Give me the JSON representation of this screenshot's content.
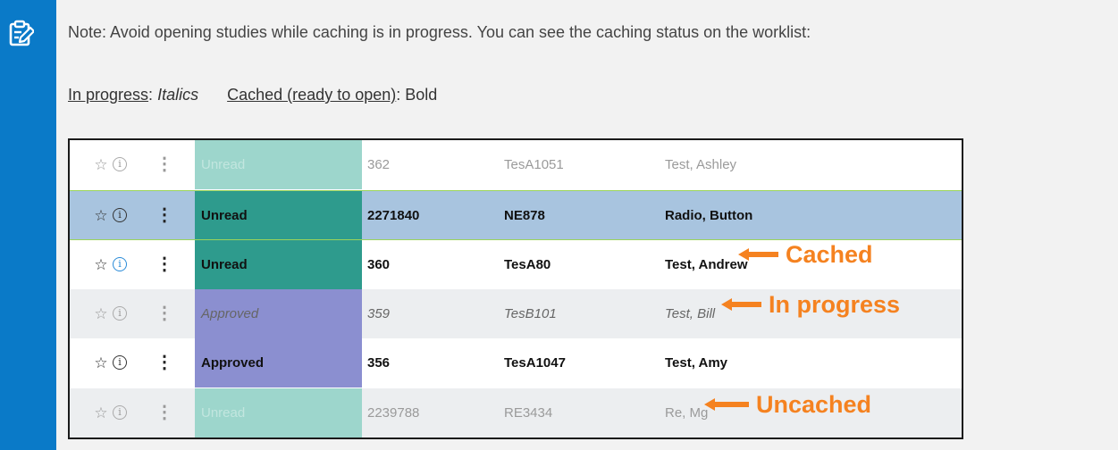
{
  "note": {
    "icon": "note-pencil-icon",
    "accent_color": "#0a7ac8",
    "text": "Note: Avoid opening studies while caching is in progress. You can see the caching status on the worklist:"
  },
  "legend": {
    "in_progress_label": "In progress",
    "colon1": ":",
    "in_progress_value": "Italics",
    "cached_label": "Cached (ready to open)",
    "colon2": ":",
    "cached_value": "Bold"
  },
  "worklist": {
    "rows": [
      {
        "status": "Unread",
        "accession": "362",
        "patient_id": "TesA1051",
        "name": "Test, Ashley",
        "state": "uncached",
        "bg": "#ffffff",
        "status_bg": "#9dd6cc",
        "selected": false
      },
      {
        "status": "Unread",
        "accession": "2271840",
        "patient_id": "NE878",
        "name": "Radio, Button",
        "state": "cached",
        "bg": "#a8c4df",
        "status_bg": "#2e9b8d",
        "selected": true
      },
      {
        "status": "Unread",
        "accession": "360",
        "patient_id": "TesA80",
        "name": "Test, Andrew",
        "state": "cached",
        "bg": "#ffffff",
        "status_bg": "#2e9b8d",
        "selected": false
      },
      {
        "status": "Approved",
        "accession": "359",
        "patient_id": "TesB101",
        "name": "Test, Bill",
        "state": "in-progress",
        "bg": "#eceef0",
        "status_bg": "#8b8fd0",
        "selected": false
      },
      {
        "status": "Approved",
        "accession": "356",
        "patient_id": "TesA1047",
        "name": "Test, Amy",
        "state": "cached",
        "bg": "#ffffff",
        "status_bg": "#8b8fd0",
        "selected": false
      },
      {
        "status": "Unread",
        "accession": "2239788",
        "patient_id": "RE3434",
        "name": "Re, Mg",
        "state": "uncached",
        "bg": "#eceef0",
        "status_bg": "#9dd6cc",
        "selected": false
      }
    ],
    "icons": {
      "star": "star-outline-icon",
      "info": "info-icon",
      "kebab": "more-vertical-icon"
    }
  },
  "callouts": {
    "cached": "Cached",
    "in_progress": "In progress",
    "uncached": "Uncached",
    "color": "#f58220"
  }
}
